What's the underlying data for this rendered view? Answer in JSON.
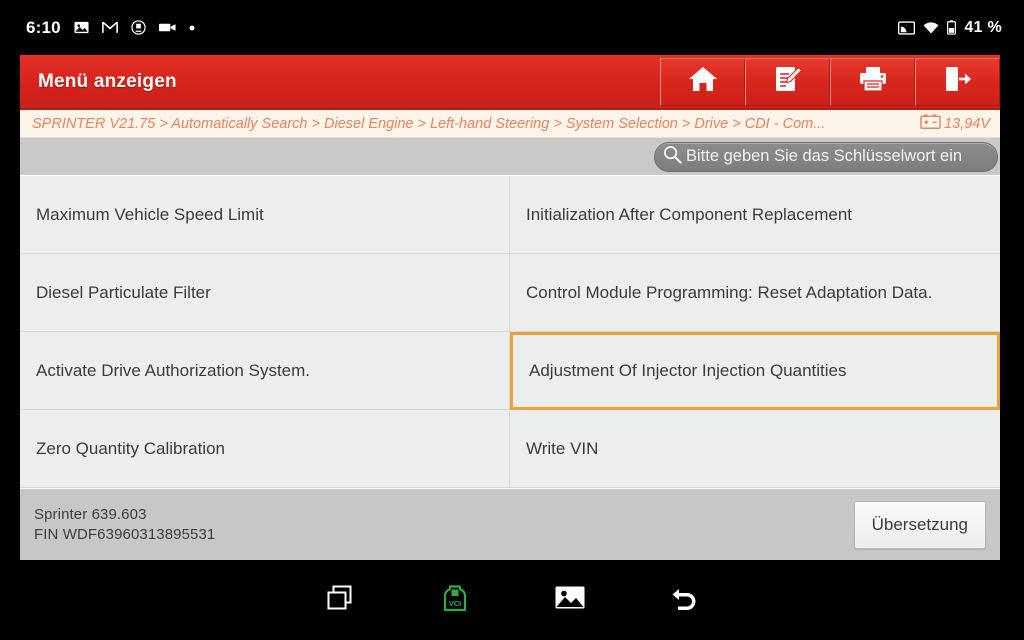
{
  "statusbar": {
    "time": "6:10",
    "left_icons": [
      "screenshot-icon",
      "gmail-icon",
      "app-icon",
      "video-icon",
      "dot-icon"
    ],
    "right_icons": [
      "cast-icon",
      "wifi-icon",
      "battery-icon"
    ],
    "battery_percent": "41 %"
  },
  "header": {
    "title": "Menü anzeigen",
    "tools": [
      {
        "name": "home-icon",
        "label": "Home"
      },
      {
        "name": "notes-edit-icon",
        "label": "Notizen"
      },
      {
        "name": "printer-icon",
        "label": "Drucken"
      },
      {
        "name": "exit-icon",
        "label": "Beenden"
      }
    ]
  },
  "breadcrumb": {
    "text": "SPRINTER V21.75 > Automatically Search > Diesel Engine > Left-hand Steering > System Selection > Drive > CDI -  Com...",
    "voltage": "13,94V",
    "voltage_icon": "car-battery-icon"
  },
  "search": {
    "icon": "search-icon",
    "placeholder": "Bitte geben Sie das Schlüsselwort ein",
    "value": ""
  },
  "menu": {
    "items": [
      {
        "label": "Maximum Vehicle Speed Limit",
        "selected": false
      },
      {
        "label": "Initialization After Component Replacement",
        "selected": false
      },
      {
        "label": "Diesel Particulate Filter",
        "selected": false
      },
      {
        "label": "Control Module Programming: Reset Adaptation Data.",
        "selected": false
      },
      {
        "label": "Activate Drive Authorization System.",
        "selected": false
      },
      {
        "label": "Adjustment Of Injector Injection Quantities",
        "selected": true
      },
      {
        "label": "Zero Quantity Calibration",
        "selected": false
      },
      {
        "label": "Write VIN",
        "selected": false
      }
    ]
  },
  "footer": {
    "vehicle_model": "Sprinter 639.603",
    "vin_line": "FIN WDF63960313895531",
    "translate_label": "Übersetzung"
  },
  "navbar": {
    "buttons": [
      {
        "name": "recents-icon",
        "label": "Recents"
      },
      {
        "name": "vci-connector-icon",
        "label": "VCI"
      },
      {
        "name": "gallery-icon",
        "label": "Gallery"
      },
      {
        "name": "back-icon",
        "label": "Back"
      }
    ],
    "vci_color": "#2faa4e"
  },
  "colors": {
    "header_red": "#d8241c",
    "accent_orange": "#e7a33a",
    "breadcrumb_text": "#e8835a",
    "panel_bg": "#eceded",
    "footer_bg": "#c7c8c6"
  }
}
